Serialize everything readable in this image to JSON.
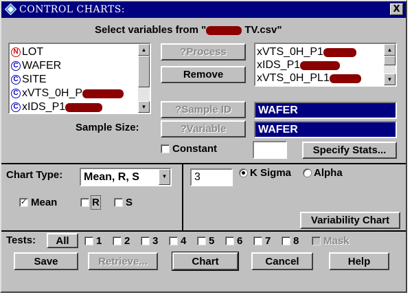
{
  "window": {
    "title": "CONTROL CHARTS:",
    "close_label": "X"
  },
  "header": {
    "select_prefix": "Select variables from \"",
    "select_suffix": " TV.csv\""
  },
  "variable_list": [
    {
      "type": "N",
      "label": "LOT",
      "redacted": false
    },
    {
      "type": "C",
      "label": "WAFER",
      "redacted": false
    },
    {
      "type": "C",
      "label": "SITE",
      "redacted": false
    },
    {
      "type": "C",
      "label": "xVTS_0H_P",
      "redacted": true
    },
    {
      "type": "C",
      "label": "xIDS_P1",
      "redacted": true
    }
  ],
  "process_list": [
    {
      "label": "xVTS_0H_P1",
      "redacted": true
    },
    {
      "label": "xIDS_P1",
      "redacted": true
    },
    {
      "label": "xVTS_0H_PL1",
      "redacted": true
    }
  ],
  "buttons": {
    "process": "?Process",
    "remove": "Remove",
    "sample_id": "?Sample ID",
    "variable": "?Variable",
    "specify_stats": "Specify Stats...",
    "variability_chart": "Variability Chart",
    "tests_all": "All",
    "save": "Save",
    "retrieve": "Retrieve...",
    "chart": "Chart",
    "cancel": "Cancel",
    "help": "Help"
  },
  "fields": {
    "sample_id_value": "WAFER",
    "sample_size_label": "Sample Size:",
    "sample_size_value": "WAFER",
    "constant_label": "Constant",
    "constant_value": "",
    "sigma_value": "3"
  },
  "chart_type": {
    "label": "Chart Type:",
    "selected": "Mean, R, S"
  },
  "stats": {
    "mean": {
      "label": "Mean",
      "checked": true
    },
    "r": {
      "label": "R",
      "checked": false
    },
    "s": {
      "label": "S",
      "checked": false
    }
  },
  "limits": {
    "k_sigma_label": "K Sigma",
    "k_sigma_selected": true,
    "alpha_label": "Alpha",
    "alpha_selected": false
  },
  "tests": {
    "label": "Tests:",
    "numbers": [
      "1",
      "2",
      "3",
      "4",
      "5",
      "6",
      "7",
      "8"
    ],
    "mask_label": "Mask"
  },
  "colors": {
    "title_bar": "#000080",
    "selection": "#000080",
    "dialog": "#c0c0c0",
    "redaction": "#8b0000"
  }
}
